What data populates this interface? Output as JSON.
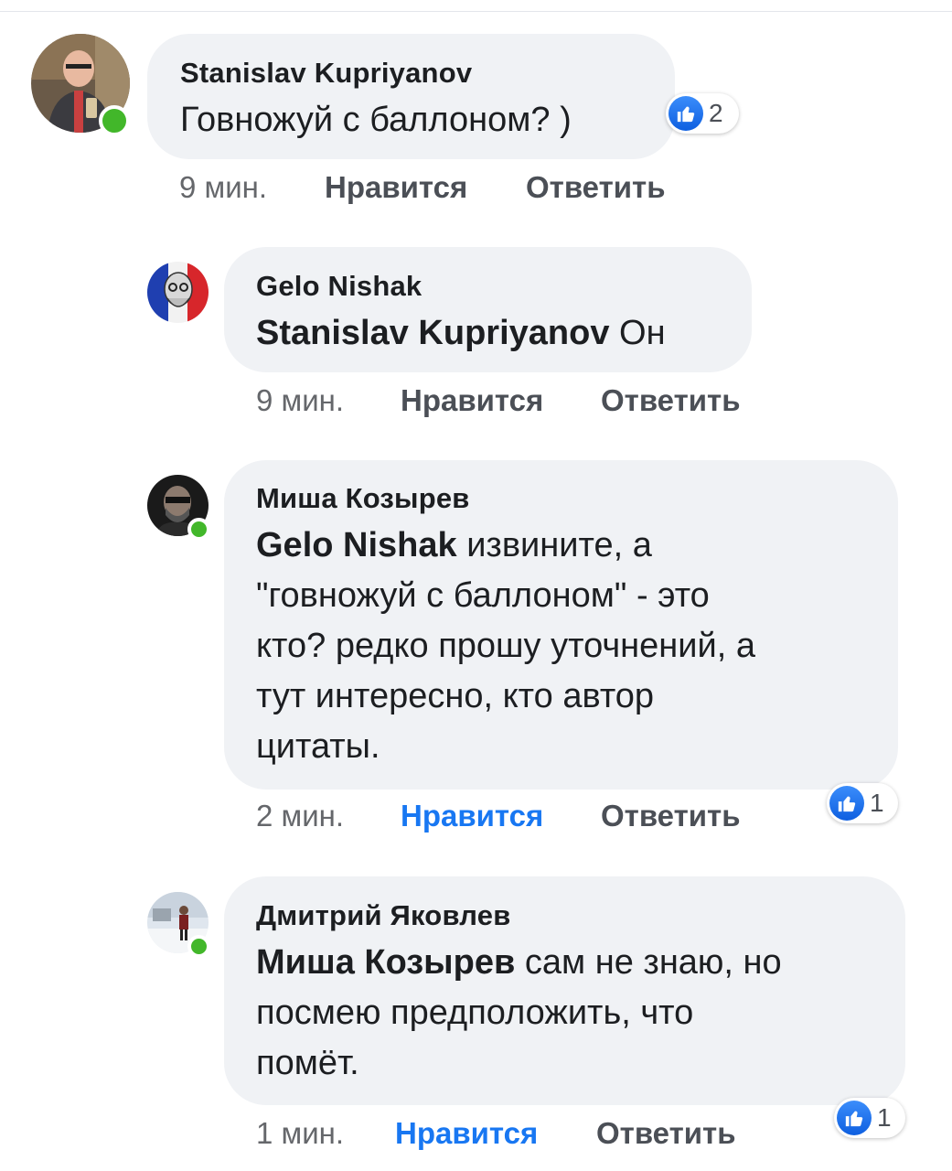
{
  "comments": [
    {
      "author": "Stanislav Kupriyanov",
      "mention": "",
      "text": "Говножуй с баллоном? )",
      "time": "9 мин.",
      "like_label": "Нравится",
      "reply_label": "Ответить",
      "liked": false,
      "reaction_count": "2",
      "online": true
    },
    {
      "author": "Gelo Nishak",
      "mention": "Stanislav Kupriyanov",
      "text": " Он",
      "time": "9 мин.",
      "like_label": "Нравится",
      "reply_label": "Ответить",
      "liked": false,
      "reaction_count": "",
      "online": false
    },
    {
      "author": "Миша Козырев",
      "mention": "Gelo Nishak",
      "text_lines": [
        " извините, а",
        "\"говножуй с баллоном\" - это",
        "кто?  редко прошу уточнений, а",
        "тут интересно, кто автор",
        "цитаты."
      ],
      "time": "2 мин.",
      "like_label": "Нравится",
      "reply_label": "Ответить",
      "liked": true,
      "reaction_count": "1",
      "online": true
    },
    {
      "author": "Дмитрий Яковлев",
      "mention": "Миша Козырев",
      "text_lines": [
        " сам не знаю, но",
        "посмею предположить, что",
        "помёт."
      ],
      "time": "1 мин.",
      "like_label": "Нравится",
      "reply_label": "Ответить",
      "liked": true,
      "reaction_count": "1",
      "online": true
    }
  ],
  "colors": {
    "bubble": "#f0f2f5",
    "link_active": "#1877f2",
    "online": "#42b72a",
    "like_icon": "#1877f2"
  },
  "icons": [
    "like-thumb-icon",
    "online-indicator"
  ]
}
